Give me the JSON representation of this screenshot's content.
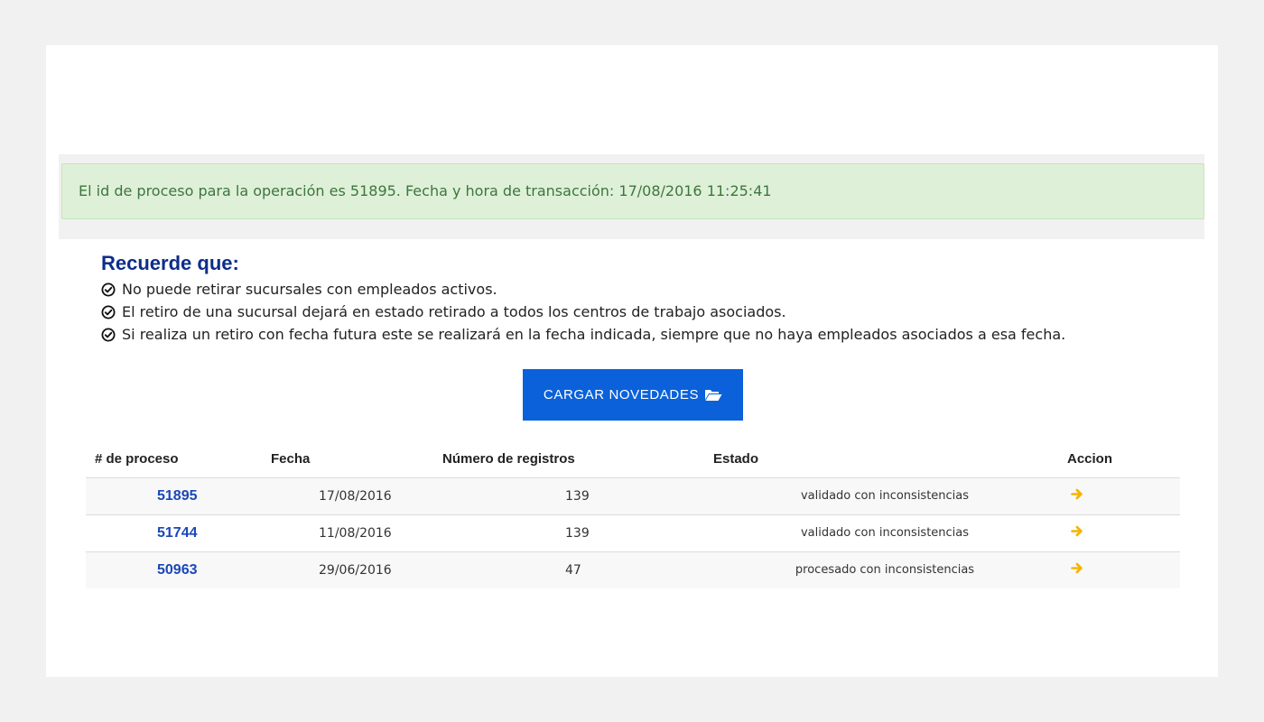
{
  "alert": {
    "message": "El id de proceso para la operación es 51895. Fecha y hora de transacción: 17/08/2016 11:25:41"
  },
  "reminder": {
    "title": "Recuerde que:",
    "items": [
      "No puede retirar sucursales con empleados activos.",
      "El retiro de una sucursal dejará en estado retirado a todos los centros de trabajo asociados.",
      "Si realiza un retiro con fecha futura este se realizará en la fecha indicada, siempre que no haya empleados asociados a esa fecha."
    ],
    "icon": "check-circle-icon"
  },
  "upload_button": {
    "label": "CARGAR NOVEDADES",
    "icon": "folder-open-icon",
    "color": "#0a61da"
  },
  "table": {
    "headers": [
      "# de proceso",
      "Fecha",
      "Número de registros",
      "Estado",
      "Accion"
    ],
    "rows": [
      {
        "process_id": "51895",
        "date": "17/08/2016",
        "records": "139",
        "status": "validado con inconsistencias"
      },
      {
        "process_id": "51744",
        "date": "11/08/2016",
        "records": "139",
        "status": "validado con inconsistencias"
      },
      {
        "process_id": "50963",
        "date": "29/06/2016",
        "records": "47",
        "status": "procesado con inconsistencias"
      }
    ],
    "action_icon": "arrow-right-icon",
    "action_color": "#f5b400"
  }
}
